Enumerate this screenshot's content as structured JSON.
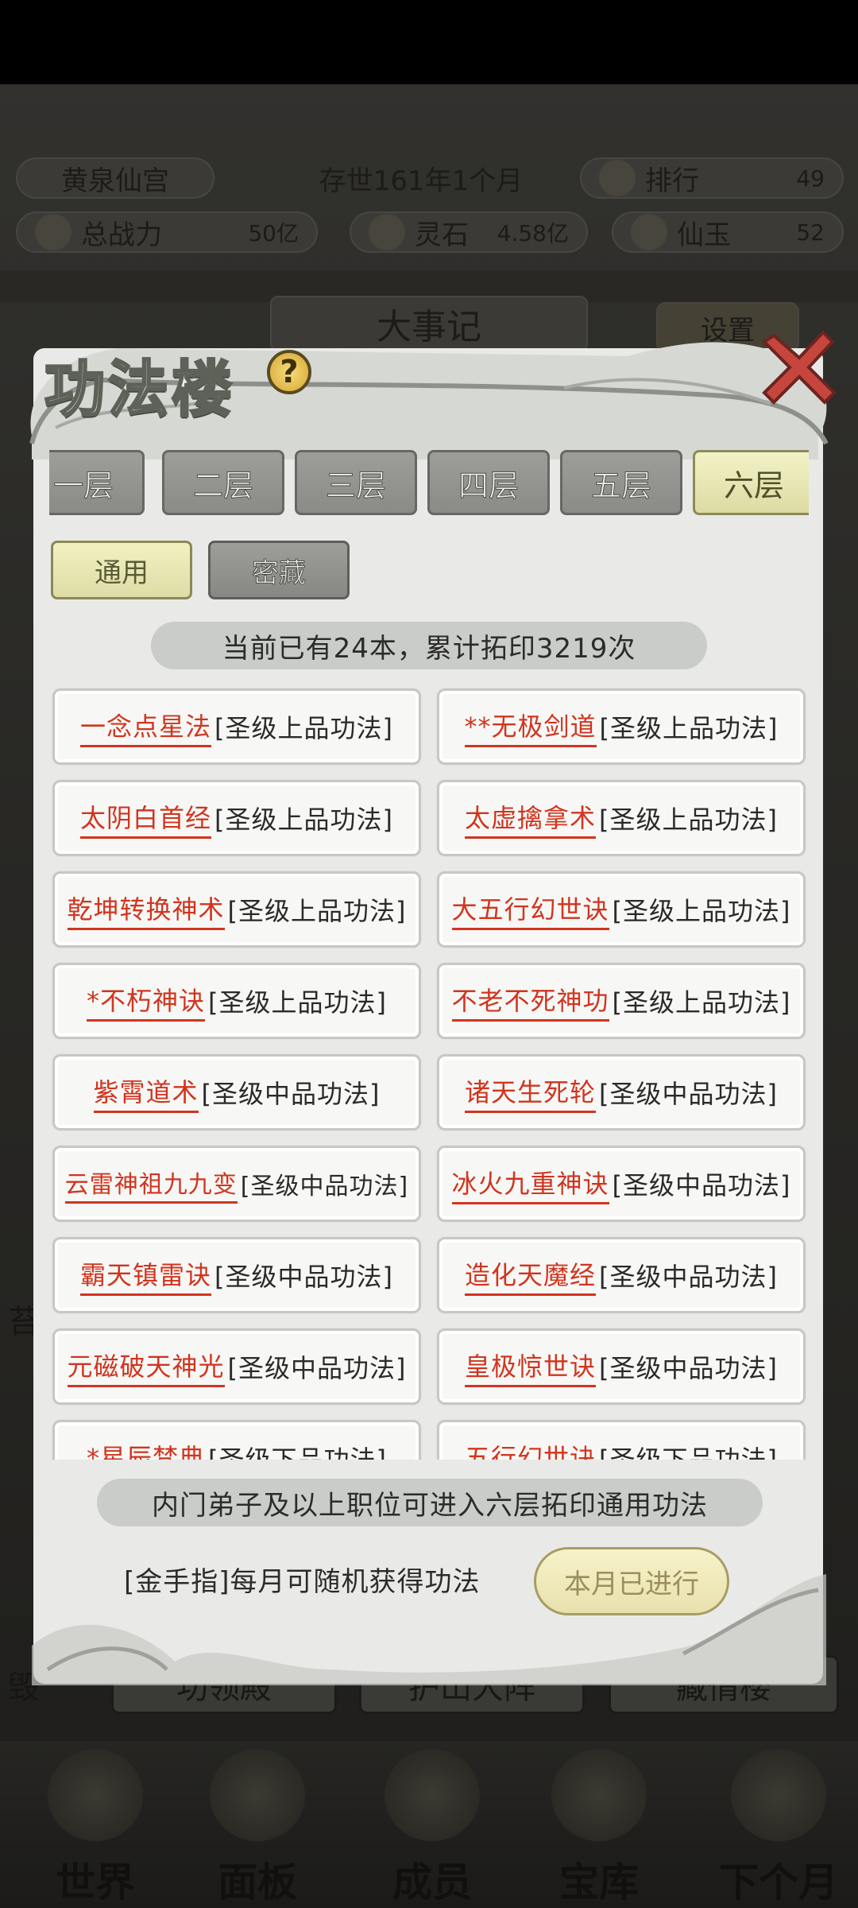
{
  "background": {
    "sect_name": "黄泉仙宫",
    "time": "存世161年1个月",
    "rank_label": "排行",
    "rank_value": "49",
    "power_label": "总战力",
    "power_value": "50亿",
    "stone_label": "灵石",
    "stone_value": "4.58亿",
    "jade_label": "仙玉",
    "jade_value": "52",
    "chronicle": "大事记",
    "settings": "设置",
    "bottom_buttons": [
      "功领殿",
      "护山大阵",
      "藏情楼"
    ],
    "side_text_left": "苔",
    "side_text_left2": "毁"
  },
  "nav": {
    "world": "世界",
    "panel": "面板",
    "members": "成员",
    "treasury": "宝库",
    "next_month": "下个月"
  },
  "modal": {
    "title": "功法楼",
    "help": "?",
    "floors": [
      "一层",
      "二层",
      "三层",
      "四层",
      "五层",
      "六层"
    ],
    "types": [
      "通用",
      "密藏"
    ],
    "summary": "当前已有24本，累计拓印3219次",
    "techniques": [
      {
        "name": "一念点星法",
        "grade": "[圣级上品功法]"
      },
      {
        "name": "**无极剑道",
        "grade": "[圣级上品功法]"
      },
      {
        "name": "太阴白首经",
        "grade": "[圣级上品功法]"
      },
      {
        "name": "太虚擒拿术",
        "grade": "[圣级上品功法]"
      },
      {
        "name": "乾坤转换神术",
        "grade": "[圣级上品功法]"
      },
      {
        "name": "大五行幻世诀",
        "grade": "[圣级上品功法]"
      },
      {
        "name": "*不朽神诀",
        "grade": "[圣级上品功法]"
      },
      {
        "name": "不老不死神功",
        "grade": "[圣级上品功法]"
      },
      {
        "name": "紫霄道术",
        "grade": "[圣级中品功法]"
      },
      {
        "name": "诸天生死轮",
        "grade": "[圣级中品功法]"
      },
      {
        "name": "云雷神祖九九变",
        "grade": "[圣级中品功法]"
      },
      {
        "name": "冰火九重神诀",
        "grade": "[圣级中品功法]"
      },
      {
        "name": "霸天镇雷诀",
        "grade": "[圣级中品功法]"
      },
      {
        "name": "造化天魔经",
        "grade": "[圣级中品功法]"
      },
      {
        "name": "元磁破天神光",
        "grade": "[圣级中品功法]"
      },
      {
        "name": "皇极惊世诀",
        "grade": "[圣级中品功法]"
      },
      {
        "name": "*星辰梵典",
        "grade": "[圣级下品功法]"
      },
      {
        "name": "五行幻世诀",
        "grade": "[圣级下品功法]"
      }
    ],
    "requirement": "内门弟子及以上职位可进入六层拓印通用功法",
    "golden_finger": "[金手指]每月可随机获得功法",
    "done_button": "本月已进行"
  },
  "colors": {
    "technique_name": "#d2341e",
    "active_tab": "#e8e7b4",
    "panel_bg": "#e9eae7"
  }
}
